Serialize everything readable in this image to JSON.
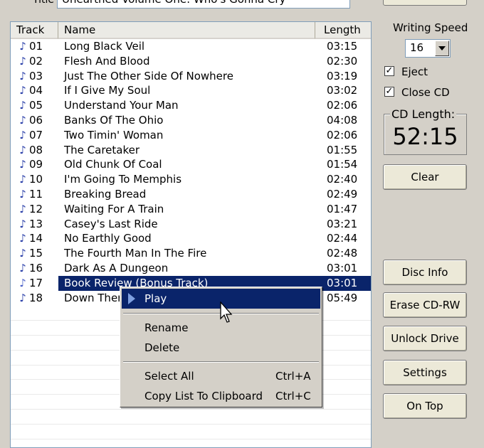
{
  "header": {
    "title_label": "Title",
    "title_value": "Unearthed Volume One: Who's Gonna Cry"
  },
  "track_list": {
    "columns": [
      "Track",
      "Name",
      "Length"
    ],
    "rows": [
      {
        "track": "01",
        "name": "Long Black Veil",
        "length": "03:15"
      },
      {
        "track": "02",
        "name": "Flesh And Blood",
        "length": "02:30"
      },
      {
        "track": "03",
        "name": "Just The Other Side Of Nowhere",
        "length": "03:19"
      },
      {
        "track": "04",
        "name": "If I Give My Soul",
        "length": "03:02"
      },
      {
        "track": "05",
        "name": "Understand Your Man",
        "length": "02:06"
      },
      {
        "track": "06",
        "name": "Banks Of The Ohio",
        "length": "04:08"
      },
      {
        "track": "07",
        "name": "Two Timin' Woman",
        "length": "02:06"
      },
      {
        "track": "08",
        "name": "The Caretaker",
        "length": "01:55"
      },
      {
        "track": "09",
        "name": "Old Chunk Of Coal",
        "length": "01:54"
      },
      {
        "track": "10",
        "name": "I'm Going To Memphis",
        "length": "02:40"
      },
      {
        "track": "11",
        "name": "Breaking Bread",
        "length": "02:49"
      },
      {
        "track": "12",
        "name": "Waiting For A Train",
        "length": "01:47"
      },
      {
        "track": "13",
        "name": "Casey's Last Ride",
        "length": "03:21"
      },
      {
        "track": "14",
        "name": "No Earthly Good",
        "length": "02:44"
      },
      {
        "track": "15",
        "name": "The Fourth Man In The Fire",
        "length": "02:48"
      },
      {
        "track": "16",
        "name": "Dark As A Dungeon",
        "length": "03:01"
      },
      {
        "track": "17",
        "name": "Book Review (Bonus Track)",
        "length": "03:01",
        "selected": true
      },
      {
        "track": "18",
        "name": "Down There By The Train",
        "length": "05:49"
      }
    ],
    "selected_color": "#0a246a"
  },
  "side_panel": {
    "writing_speed_label": "Writing Speed",
    "writing_speed_value": "16",
    "eject_label": "Eject",
    "eject_checked": true,
    "close_cd_label": "Close CD",
    "close_cd_checked": true,
    "cd_length_label": "CD Length:",
    "cd_length_value": "52:15",
    "clear_label": "Clear",
    "disc_info_label": "Disc Info",
    "erase_label": "Erase CD-RW",
    "unlock_label": "Unlock Drive",
    "settings_label": "Settings",
    "on_top_label": "On Top"
  },
  "context_menu": {
    "play": "Play",
    "rename": "Rename",
    "delete": "Delete",
    "select_all": "Select All",
    "select_all_shortcut": "Ctrl+A",
    "copy_list": "Copy List To Clipboard",
    "copy_list_shortcut": "Ctrl+C"
  }
}
